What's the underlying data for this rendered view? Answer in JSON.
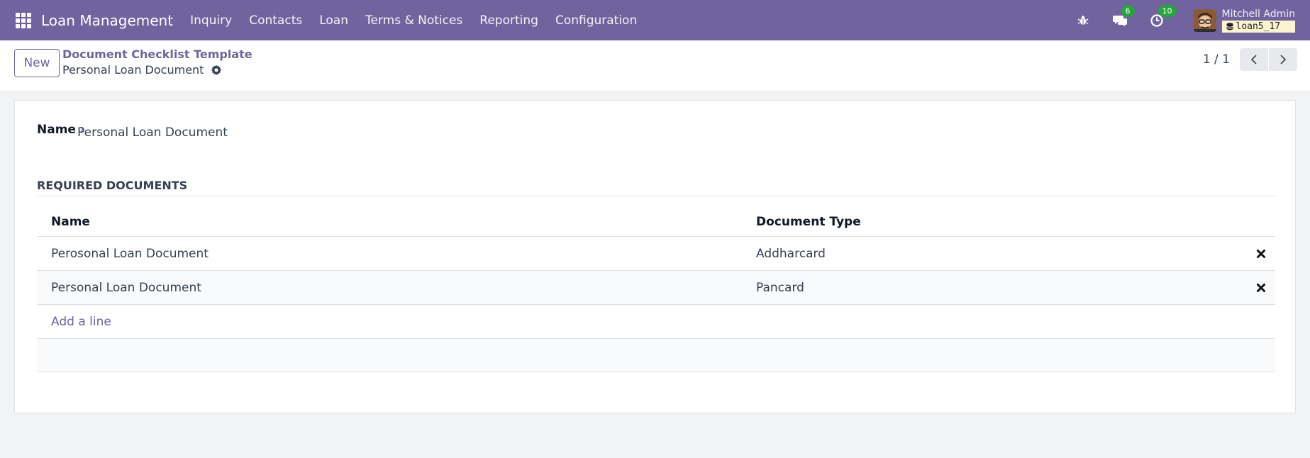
{
  "navbar": {
    "app_name": "Loan Management",
    "menu": [
      "Inquiry",
      "Contacts",
      "Loan",
      "Terms & Notices",
      "Reporting",
      "Configuration"
    ],
    "messages_count": "6",
    "activities_count": "10",
    "user_name": "Mitchell Admin",
    "database": "loan5_17",
    "accent_color": "#71639e"
  },
  "control": {
    "new_label": "New",
    "breadcrumb_parent": "Document Checklist Template",
    "breadcrumb_current": "Personal Loan Document",
    "pager": "1 / 1"
  },
  "form": {
    "name_label": "Name",
    "name_help": "?",
    "name_value": "Personal Loan Document",
    "section_title": "REQUIRED DOCUMENTS",
    "columns": [
      "Name",
      "Document Type"
    ],
    "rows": [
      {
        "name": "Perosonal Loan Document",
        "type": "Addharcard"
      },
      {
        "name": "Personal Loan Document",
        "type": "Pancard"
      }
    ],
    "add_line": "Add a line"
  },
  "icons": [
    "apps-icon",
    "bug-icon",
    "chat-icon",
    "clock-icon",
    "database-icon",
    "gear-icon",
    "chevron-left-icon",
    "chevron-right-icon",
    "delete-icon"
  ]
}
